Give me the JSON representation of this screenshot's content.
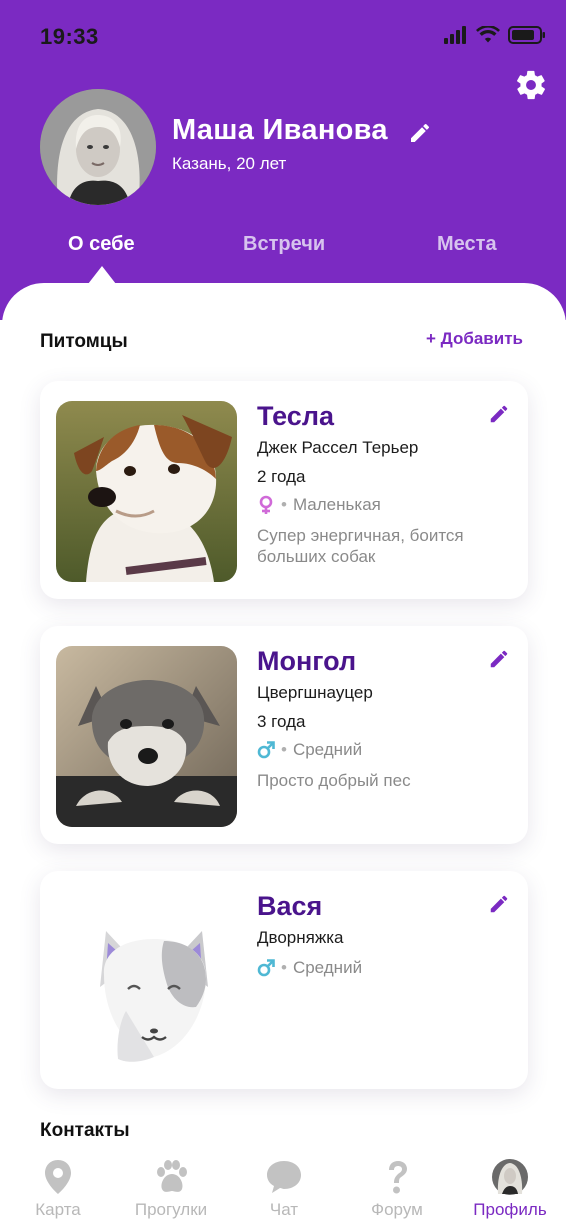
{
  "status_bar": {
    "time": "19:33"
  },
  "profile": {
    "name": "Маша Иванова",
    "subtitle": "Казань, 20 лет"
  },
  "tabs": [
    {
      "label": "О себе",
      "active": true
    },
    {
      "label": "Встречи",
      "active": false
    },
    {
      "label": "Места",
      "active": false
    }
  ],
  "pets_section": {
    "title": "Питомцы",
    "add_label": "+ Добавить"
  },
  "pets": [
    {
      "name": "Тесла",
      "breed": "Джек Рассел Терьер",
      "age": "2 года",
      "gender": "female",
      "size": "Маленькая",
      "description": "Супер энергичная, боится больших собак"
    },
    {
      "name": "Монгол",
      "breed": "Цвергшнауцер",
      "age": "3 года",
      "gender": "male",
      "size": "Средний",
      "description": "Просто добрый пес"
    },
    {
      "name": "Вася",
      "breed": "Дворняжка",
      "gender": "male",
      "size": "Средний"
    }
  ],
  "contacts_section": {
    "title": "Контакты"
  },
  "bottom_nav": [
    {
      "label": "Карта",
      "icon": "map-pin-icon",
      "active": false
    },
    {
      "label": "Прогулки",
      "icon": "paw-icon",
      "active": false
    },
    {
      "label": "Чат",
      "icon": "chat-bubble-icon",
      "active": false
    },
    {
      "label": "Форум",
      "icon": "question-mark-icon",
      "active": false
    },
    {
      "label": "Профиль",
      "icon": "profile-avatar-icon",
      "active": true
    }
  ],
  "colors": {
    "accent": "#7b2ac2",
    "pet_name": "#4a148c",
    "female": "#d06ad8",
    "male": "#4fb8d4"
  }
}
